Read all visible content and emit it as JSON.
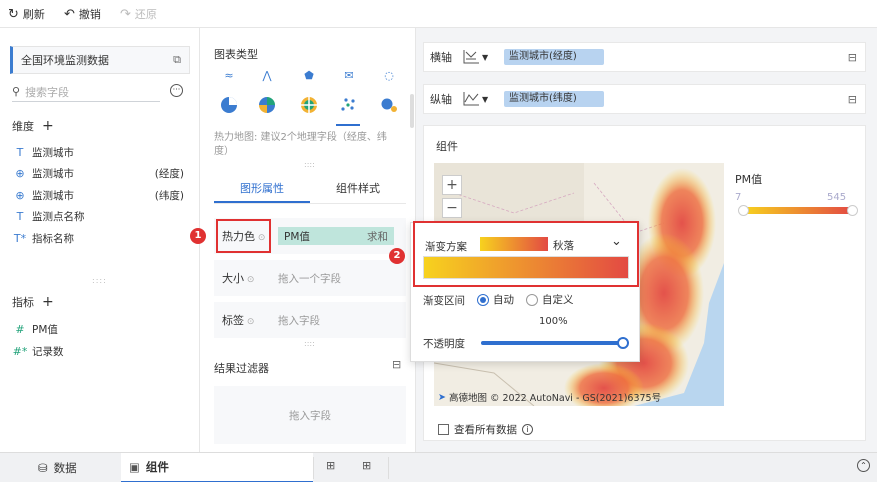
{
  "toolbar": {
    "refresh": "刷新",
    "undo": "撤销",
    "redo": "还原"
  },
  "left": {
    "dataset": "全国环境监测数据",
    "search_placeholder": "搜索字段",
    "dim_title": "维度",
    "measure_title": "指标",
    "dims": [
      {
        "icon": "T",
        "label": "监测城市",
        "suffix": ""
      },
      {
        "icon": "globe",
        "label": "监测城市",
        "suffix": "(经度)"
      },
      {
        "icon": "globe",
        "label": "监测城市",
        "suffix": "(纬度)"
      },
      {
        "icon": "T",
        "label": "监测点名称",
        "suffix": ""
      },
      {
        "icon": "T*",
        "label": "指标名称",
        "suffix": ""
      }
    ],
    "measures": [
      {
        "icon": "#",
        "label": "PM值"
      },
      {
        "icon": "#*",
        "label": "记录数"
      }
    ]
  },
  "mid": {
    "chart_type_title": "图表类型",
    "hint": "热力地图: 建议2个地理字段（经度、纬度）",
    "tab_graph": "图形属性",
    "tab_style": "组件样式",
    "heat_label": "热力色",
    "heat_field": "PM值",
    "heat_agg": "求和",
    "size_label": "大小",
    "size_ph": "拖入一个字段",
    "tag_label": "标签",
    "tag_ph": "拖入字段",
    "filter_title": "结果过滤器",
    "filter_ph": "拖入字段"
  },
  "axes": {
    "x_label": "横轴",
    "x_field": "监测城市(经度)",
    "y_label": "纵轴",
    "y_field": "监测城市(纬度)"
  },
  "widget": {
    "title": "组件",
    "legend_title": "PM值",
    "legend_min": "7",
    "legend_max": "545",
    "attribution": "高德地图 © 2022 AutoNavi - GS(2021)6375号",
    "show_all": "查看所有数据"
  },
  "popup": {
    "scheme_label": "渐变方案",
    "scheme_name": "秋落",
    "range_label": "渐变区间",
    "auto": "自动",
    "custom": "自定义",
    "opacity_label": "不透明度",
    "opacity_value": "100%",
    "opacity": 1.0
  },
  "badges": {
    "b1": "1",
    "b2": "2"
  },
  "bottom": {
    "data_tab": "数据",
    "component_tab": "组件"
  },
  "colors": {
    "accent": "#2f6fcf",
    "gradient_start": "#f7d21e",
    "gradient_end": "#e34a43",
    "highlight": "#e03131"
  }
}
